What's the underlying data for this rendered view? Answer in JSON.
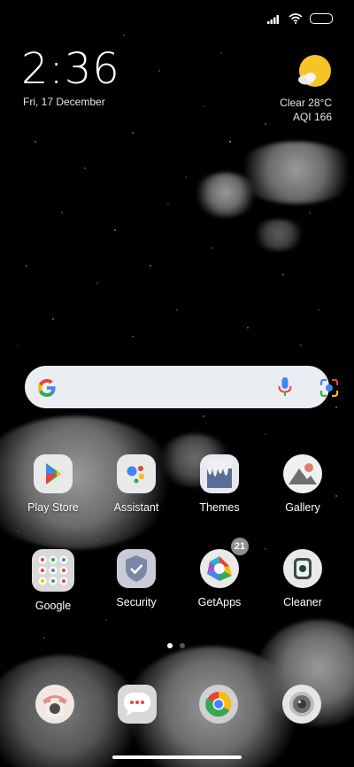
{
  "status_bar": {
    "icons": [
      "signal-icon",
      "wifi-icon",
      "battery-icon"
    ]
  },
  "clock": {
    "time": "2:36",
    "date": "Fri, 17 December"
  },
  "weather": {
    "condition_temp": "Clear  28°C",
    "aqi": "AQI 166",
    "icon": "sun-cloud-icon"
  },
  "search": {
    "icons": [
      "google-logo-icon",
      "microphone-icon",
      "lens-camera-icon"
    ]
  },
  "apps": {
    "row1": [
      {
        "label": "Play Store"
      },
      {
        "label": "Assistant"
      },
      {
        "label": "Themes"
      },
      {
        "label": "Gallery"
      }
    ],
    "row2": [
      {
        "label": "Google"
      },
      {
        "label": "Security"
      },
      {
        "label": "GetApps",
        "badge": "21"
      },
      {
        "label": "Cleaner"
      }
    ]
  },
  "page_indicator": {
    "pages": 2,
    "active": 1
  },
  "dock": [
    "phone-icon",
    "messages-icon",
    "chrome-icon",
    "camera-icon"
  ],
  "colors": {
    "search_bg": "#eaedf2",
    "google_blue": "#4285F4",
    "google_red": "#EA4335",
    "google_yellow": "#FBBC05",
    "google_green": "#34A853"
  }
}
